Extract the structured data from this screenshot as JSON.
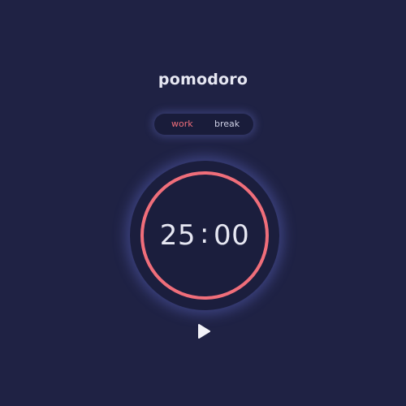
{
  "app": {
    "title": "pomodoro"
  },
  "modes": {
    "work_label": "work",
    "break_label": "break",
    "active": "work"
  },
  "timer": {
    "minutes": "25",
    "separator": ":",
    "seconds": "00",
    "progress_fraction": 1.0
  },
  "controls": {
    "play_icon": "play-icon"
  },
  "colors": {
    "background": "#1f2244",
    "accent": "#f06e7a",
    "text": "#e6e7f2",
    "glow": "#6e78e6"
  }
}
